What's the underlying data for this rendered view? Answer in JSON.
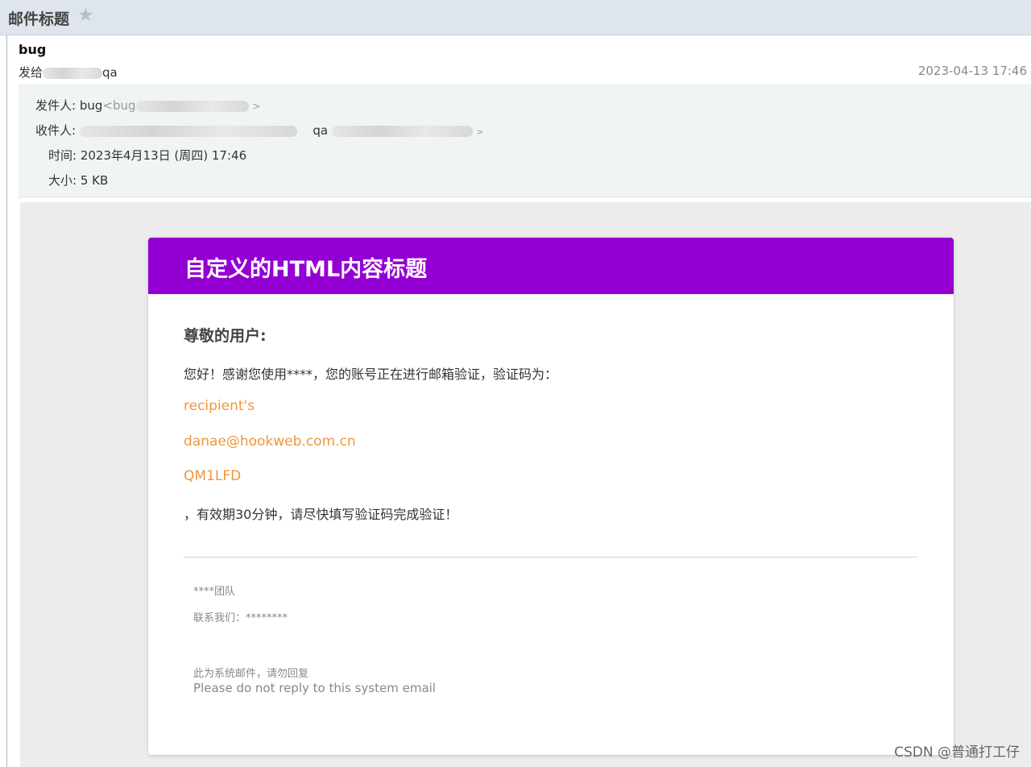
{
  "window": {
    "subject_title": "邮件标题"
  },
  "mail": {
    "subject": "bug",
    "to_prefix": "发给",
    "to_suffix": "qa",
    "date": "2023-04-13 17:46"
  },
  "meta": {
    "from_label": "发件人:",
    "from_name": "bug",
    "from_addr_open": "<bug",
    "from_addr_close": ">",
    "to_label": "收件人:",
    "to_name2": "qa",
    "to_close": ">",
    "time_label": "时间:",
    "time_value": "2023年4月13日 (周四) 17:46",
    "size_label": "大小:",
    "size_value": "5 KB"
  },
  "email": {
    "header_title": "自定义的HTML内容标题",
    "greeting": "尊敬的用户:",
    "line1": "您好！感谢您使用****，您的账号正在进行邮箱验证，验证码为：",
    "recipient": "recipient's",
    "email_addr": "danae@hookweb.com.cn",
    "code": "QM1LFD",
    "line_end": "，有效期30分钟，请尽快填写验证码完成验证！",
    "team": "****团队",
    "contact": "联系我们：********",
    "noreply_cn": "此为系统邮件，请勿回复",
    "noreply_en": "Please do not reply to this system email"
  },
  "watermark": "CSDN @普通打工仔",
  "colors": {
    "header_purple": "#9400d3",
    "accent_orange": "#f0963c",
    "topbar": "#dfe5ec"
  }
}
